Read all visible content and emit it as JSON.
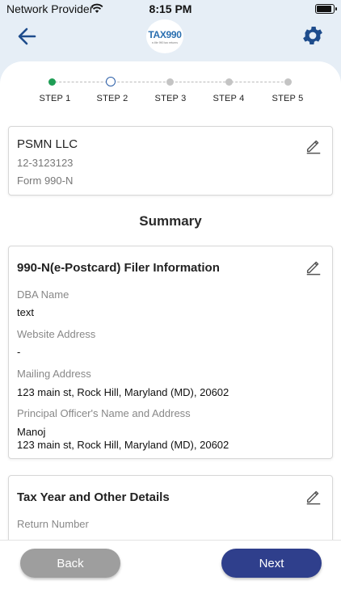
{
  "status_bar": {
    "carrier": "Network Provider",
    "time": "8:15 PM"
  },
  "header": {
    "logo_text": "TAX990",
    "logo_tagline": "e-file 990 tax returns",
    "accent_color": "#1e4c8c"
  },
  "stepper": {
    "steps": [
      {
        "label": "STEP 1",
        "state": "done"
      },
      {
        "label": "STEP 2",
        "state": "current"
      },
      {
        "label": "STEP 3",
        "state": "pending"
      },
      {
        "label": "STEP 4",
        "state": "pending"
      },
      {
        "label": "STEP 5",
        "state": "pending"
      }
    ]
  },
  "organization": {
    "name": "PSMN LLC",
    "ein": "12-3123123",
    "form": "Form 990-N"
  },
  "summary_title": "Summary",
  "filer_info": {
    "title": "990-N(e-Postcard) Filer Information",
    "dba_label": "DBA Name",
    "dba_value": "text",
    "website_label": "Website Address",
    "website_value": "-",
    "mailing_label": "Mailing Address",
    "mailing_value": "123 main st, Rock Hill, Maryland (MD), 20602",
    "officer_label": "Principal Officer's Name and Address",
    "officer_name": "Manoj",
    "officer_address": "123 main st, Rock Hill, Maryland (MD), 20602"
  },
  "tax_details": {
    "title": "Tax Year and Other Details",
    "return_number_label": "Return Number"
  },
  "buttons": {
    "back": "Back",
    "next": "Next"
  }
}
